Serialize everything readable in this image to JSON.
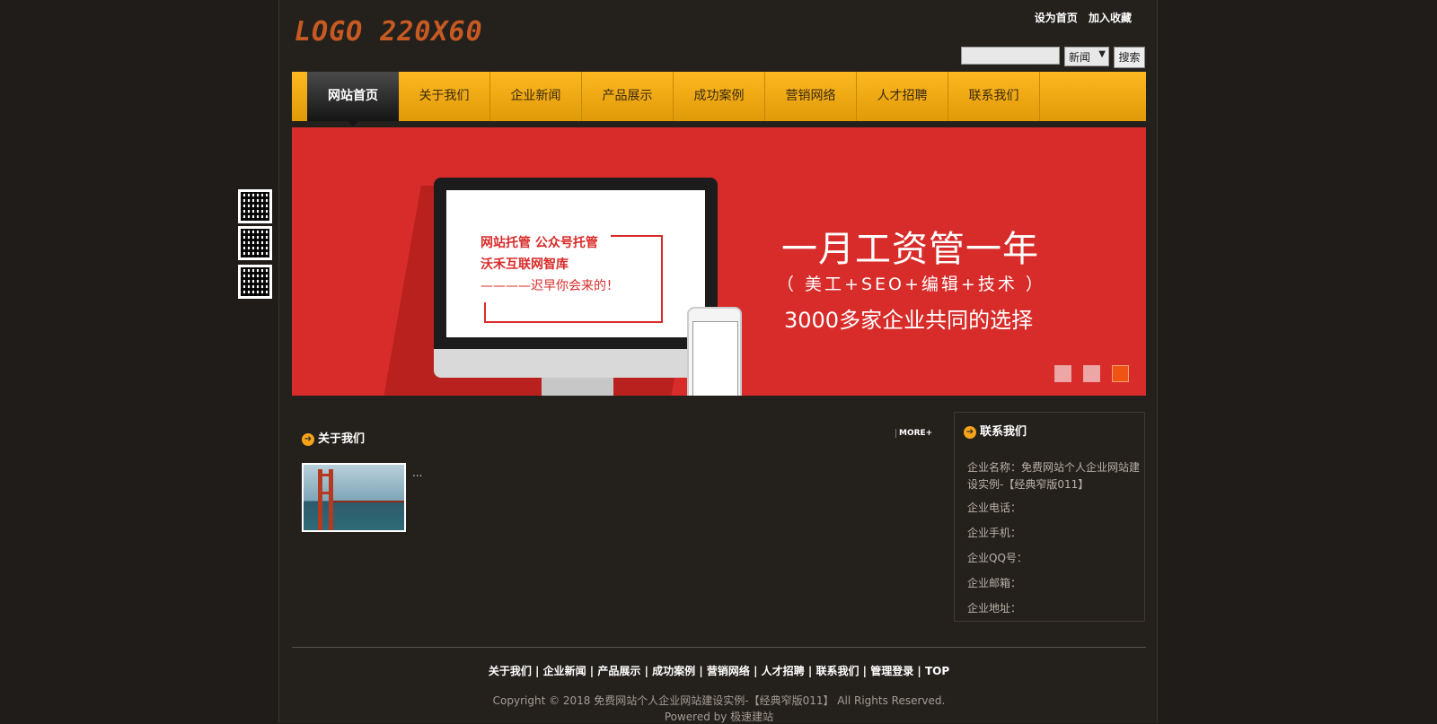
{
  "header": {
    "logo": "LOGO 220X60",
    "links": [
      "设为首页",
      "加入收藏"
    ],
    "search": {
      "value": "",
      "select_value": "新闻",
      "button": "搜索"
    }
  },
  "nav": {
    "items": [
      "网站首页",
      "关于我们",
      "企业新闻",
      "产品展示",
      "成功案例",
      "营销网络",
      "人才招聘",
      "联系我们"
    ],
    "active": "网站首页"
  },
  "banner": {
    "screen_lines": [
      "网站托管  公众号托管",
      "沃禾互联网智库",
      "————迟早你会来的！"
    ],
    "title": "一月工资管一年",
    "subtitle": "（ 美工+SEO+编辑+技术 ）",
    "subtitle2": "3000多家企业共同的选择",
    "slide_count": 3,
    "active_slide": 3,
    "accent": "#d82c2a"
  },
  "about": {
    "title": "关于我们",
    "more": "MORE+",
    "excerpt": "..."
  },
  "contact": {
    "title": "联系我们",
    "lines": [
      "企业名称：免费网站个人企业网站建设实例-【经典窄版011】",
      "企业电话：",
      "企业手机：",
      "企业QQ号：",
      "企业邮箱：",
      "企业地址："
    ]
  },
  "footer": {
    "links": [
      "关于我们",
      "企业新闻",
      "产品展示",
      "成功案例",
      "营销网络",
      "人才招聘",
      "联系我们",
      "管理登录",
      "TOP"
    ],
    "copyright": "Copyright © 2018 免费网站个人企业网站建设实例-【经典窄版011】 All Rights Reserved.",
    "powered": "Powered by 极速建站"
  },
  "colors": {
    "nav": "#fdb820",
    "background": "#24211d",
    "logo": "#c75a22"
  },
  "icons": [
    "qr-code-icon",
    "arrow-right-icon"
  ]
}
